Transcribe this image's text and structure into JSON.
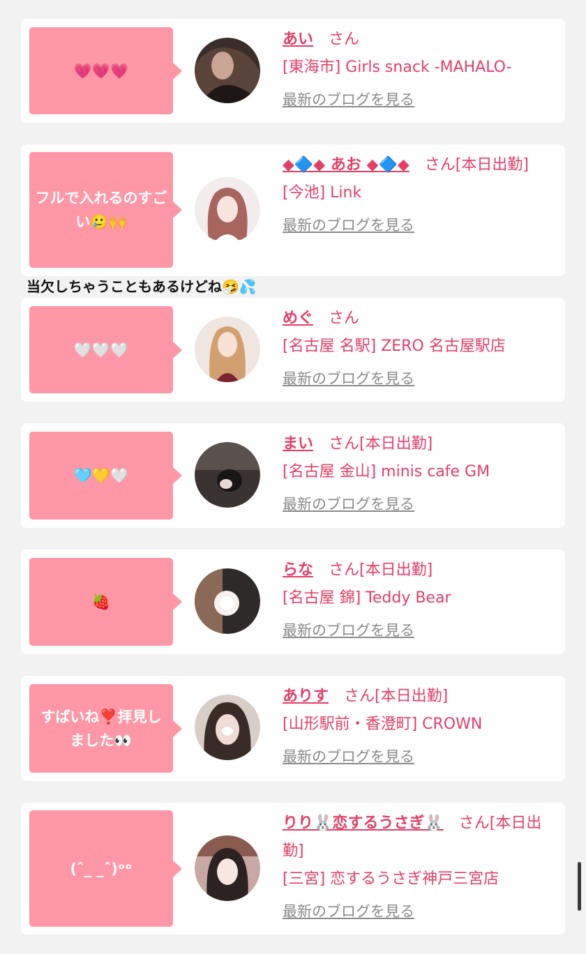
{
  "feed": {
    "cards": [
      {
        "bubble": "💗💗💗",
        "name": "あい",
        "san": "さん",
        "shop": "[東海市] Girls snack -MAHALO-",
        "blog": "最新のブログを見る"
      },
      {
        "bubble": "フルで入れるのすごい🥲🙌",
        "name": "◆🔷◆ あお ◆🔷◆",
        "san": "さん[本日出勤]",
        "shop": "[今池] Link",
        "blog": "最新のブログを見る"
      },
      {
        "bubble": "🤍🤍🤍",
        "name": "めぐ",
        "san": "さん",
        "shop": "[名古屋 名駅] ZERO 名古屋駅店",
        "blog": "最新のブログを見る"
      },
      {
        "bubble": "🩵💛🤍",
        "name": "まい",
        "san": "さん[本日出勤]",
        "shop": "[名古屋 金山] minis cafe GM",
        "blog": "最新のブログを見る"
      },
      {
        "bubble": "🍓",
        "name": "らな",
        "san": "さん[本日出勤]",
        "shop": "[名古屋 錦] Teddy Bear",
        "blog": "最新のブログを見る"
      },
      {
        "bubble": "すばいね❣️拝見しました👀",
        "name": "ありす",
        "san": "さん[本日出勤]",
        "shop": "[山形駅前・香澄町] CROWN",
        "blog": "最新のブログを見る"
      },
      {
        "bubble": "(ˆ_ _ˆ)ᵒᵒ",
        "name": "りり🐰恋するうさぎ🐰",
        "san": "さん[本日出勤]",
        "shop": "[三宮] 恋するうさぎ神戸三宮店",
        "blog": "最新のブログを見る"
      }
    ],
    "interlude_text": "当欠しちゃうこともあるけどね🤧💦"
  },
  "colors": {
    "background": "#f2f2f2",
    "card": "#ffffff",
    "bubble": "#ff97a6",
    "name_pink": "#e63d66",
    "blog_gray": "#8a8a8a"
  },
  "icons": {
    "avatar": "avatar-photo",
    "scroll": "scrollbar-thumb"
  }
}
